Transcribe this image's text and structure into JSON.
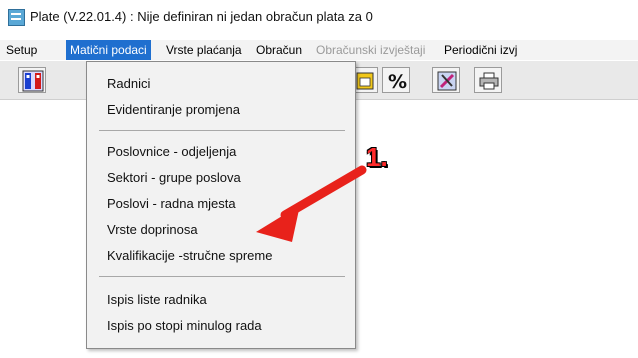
{
  "window": {
    "title": "Plate (V.22.01.4) : Nije definiran ni jedan obračun plata za 0",
    "icon": "app-icon"
  },
  "menubar": {
    "items": [
      {
        "label": "Setup",
        "state": "normal"
      },
      {
        "label": "Matični podaci",
        "state": "active"
      },
      {
        "label": "Vrste plaćanja",
        "state": "normal"
      },
      {
        "label": "Obračun",
        "state": "normal"
      },
      {
        "label": "Obračunski izvještaji",
        "state": "disabled"
      },
      {
        "label": "Periodični izvj",
        "state": "normal"
      }
    ]
  },
  "toolbar": {
    "buttons": [
      {
        "icon": "workers-icon"
      },
      {
        "icon": "calendar-icon"
      },
      {
        "icon": "percent-icon"
      },
      {
        "icon": "tools-icon"
      },
      {
        "icon": "printer-icon"
      }
    ]
  },
  "dropdown": {
    "groups": [
      [
        "Radnici",
        "Evidentiranje promjena"
      ],
      [
        "Poslovnice - odjeljenja",
        "Sektori - grupe poslova",
        "Poslovi - radna mjesta",
        "Vrste doprinosa",
        "Kvalifikacije -stručne spreme"
      ],
      [
        "Ispis liste radnika",
        "Ispis po stopi minulog rada"
      ]
    ]
  },
  "annotation": {
    "label": "1.",
    "color": "#ff2a2a"
  },
  "colors": {
    "menu_active_bg": "#1f6fcf",
    "menu_disabled": "#9a9a9a"
  }
}
